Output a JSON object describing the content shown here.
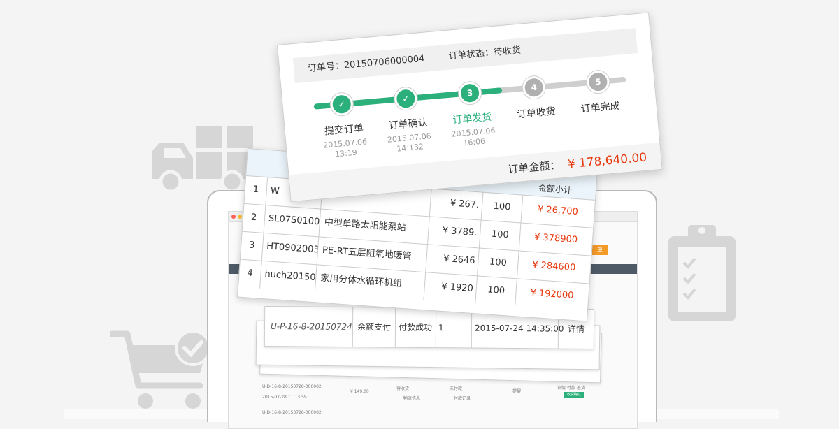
{
  "colors": {
    "accent_green": "#2bb07c",
    "price_red": "#e8380d",
    "grey_step": "#b0b0b0"
  },
  "order": {
    "number_label": "订单号：",
    "number": "20150706000004",
    "status_label": "订单状态：",
    "status": "待收货",
    "amount_label": "订单金额：",
    "amount": "¥ 178,640.00",
    "steps": [
      {
        "num": "✓",
        "label": "提交订单",
        "date": "2015.07.06",
        "time": "13:19",
        "state": "done"
      },
      {
        "num": "✓",
        "label": "订单确认",
        "date": "2015.07.06",
        "time": "14:132",
        "state": "done"
      },
      {
        "num": "3",
        "label": "订单发货",
        "date": "2015.07.06",
        "time": "16:06",
        "state": "current"
      },
      {
        "num": "4",
        "label": "订单收货",
        "date": "",
        "time": "",
        "state": "todo"
      },
      {
        "num": "5",
        "label": "订单完成",
        "date": "",
        "time": "",
        "state": "todo"
      }
    ]
  },
  "table": {
    "header_partial": "金额小计",
    "rows": [
      {
        "idx": "1",
        "code": "W",
        "name": "",
        "price": "¥ 267.",
        "qty": "100",
        "subtotal": "¥ 26,700"
      },
      {
        "idx": "2",
        "code": "SL07S01003I",
        "name": "中型单路太阳能泵站",
        "price": "¥ 3789.",
        "qty": "100",
        "subtotal": "¥ 378900"
      },
      {
        "idx": "3",
        "code": "HT0902003I",
        "name": "PE-RT五层阻氧地暖管",
        "price": "¥ 2646",
        "qty": "100",
        "subtotal": "¥ 284600"
      },
      {
        "idx": "4",
        "code": "huch201504",
        "name": "家用分体水循环机组",
        "price": "¥ 1920",
        "qty": "100",
        "subtotal": "¥ 192000"
      }
    ]
  },
  "payment_row": {
    "id": "U-P-16-8-20150724",
    "method": "余额支付",
    "status": "付款成功",
    "count": "1",
    "time": "2015-07-24 14:35:00",
    "action": "详情"
  },
  "laptop_mini": {
    "order_id": "U-D-16-8-20150728-000002",
    "order_date": "2015-07-28 11:13:59",
    "amount": "¥ 149.00",
    "status": "待收货",
    "logistics": "物流信息",
    "paid": "未付款",
    "pay_record": "付款记录",
    "remind": "提醒",
    "links": "详情  付款  退货",
    "confirm": "收货确认",
    "order_id2": "U-D-16-8-20150728-000002"
  },
  "btn_orange": "单"
}
